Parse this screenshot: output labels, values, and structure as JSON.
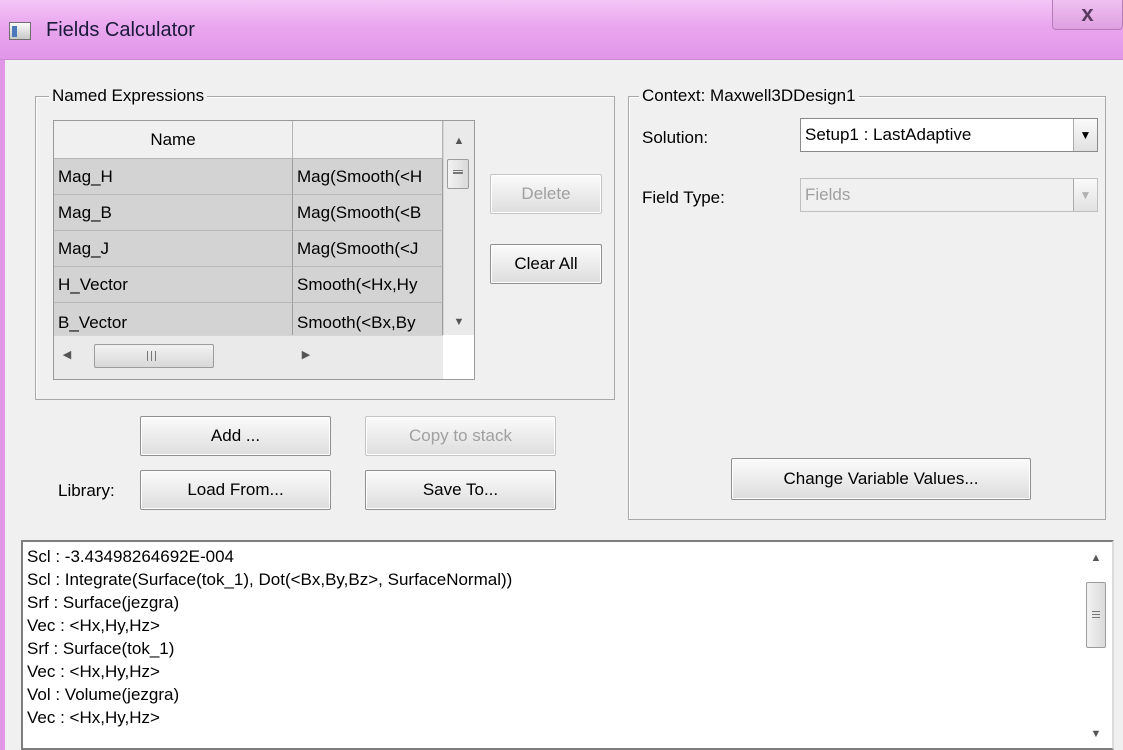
{
  "window": {
    "title": "Fields Calculator",
    "close_glyph": "x",
    "app_icon": "app-icon",
    "accent": "#e196e8"
  },
  "named_expressions": {
    "group_label": "Named Expressions",
    "columns": [
      "Name",
      ""
    ],
    "rows": [
      {
        "name": "Mag_H",
        "expr": "Mag(Smooth(<H"
      },
      {
        "name": "Mag_B",
        "expr": "Mag(Smooth(<B"
      },
      {
        "name": "Mag_J",
        "expr": "Mag(Smooth(<J"
      },
      {
        "name": "H_Vector",
        "expr": "Smooth(<Hx,Hy"
      },
      {
        "name": "B_Vector",
        "expr": "Smooth(<Bx,By"
      }
    ],
    "delete_label": "Delete",
    "clear_all_label": "Clear All"
  },
  "actions": {
    "add_label": "Add ...",
    "copy_label": "Copy to stack",
    "library_label": "Library:",
    "load_label": "Load From...",
    "save_label": "Save To..."
  },
  "context": {
    "group_label": "Context: Maxwell3DDesign1",
    "solution_label": "Solution:",
    "solution_value": "Setup1 : LastAdaptive",
    "field_type_label": "Field Type:",
    "field_type_value": "Fields",
    "change_vars_label": "Change Variable Values..."
  },
  "stack": {
    "lines": [
      "Scl : -3.43498264692E-004",
      "Scl : Integrate(Surface(tok_1), Dot(<Bx,By,Bz>, SurfaceNormal))",
      "Srf : Surface(jezgra)",
      "Vec : <Hx,Hy,Hz>",
      "Srf : Surface(tok_1)",
      "Vec : <Hx,Hy,Hz>",
      "Vol : Volume(jezgra)",
      "Vec : <Hx,Hy,Hz>"
    ]
  }
}
